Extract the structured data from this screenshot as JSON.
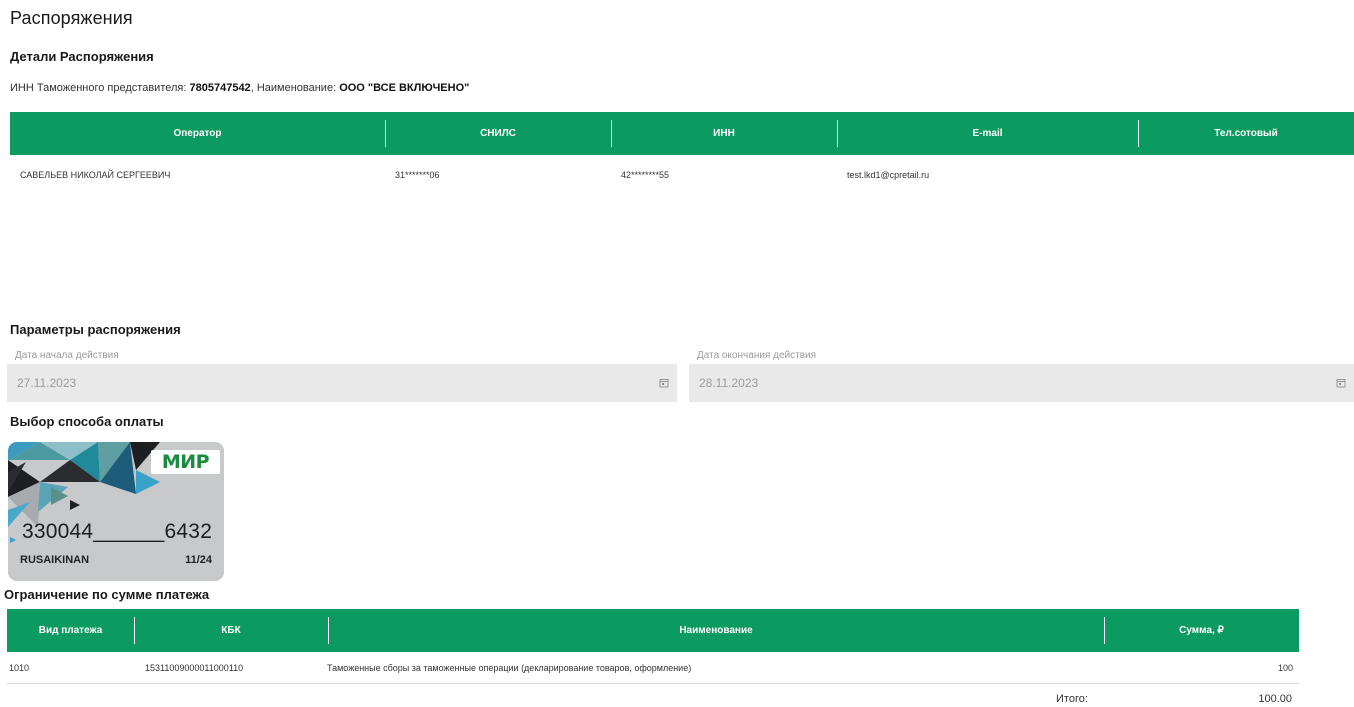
{
  "page": {
    "title": "Распоряжения"
  },
  "details": {
    "title": "Детали Распоряжения",
    "inn_label": "ИНН Таможенного представителя:",
    "inn_value": "7805747542",
    "name_label": "Наименование:",
    "name_value": "ООО \"ВСЕ ВКЛЮЧЕНО\""
  },
  "operators_table": {
    "headers": [
      "Оператор",
      "СНИЛС",
      "ИНН",
      "E-mail",
      "Тел.сотовый"
    ],
    "rows": [
      {
        "operator": "САВЕЛЬЕВ НИКОЛАЙ СЕРГЕЕВИЧ",
        "snils": "31*******06",
        "inn": "42********55",
        "email": "test.lkd1@cpretail.ru",
        "phone": ""
      }
    ]
  },
  "params": {
    "title": "Параметры распоряжения",
    "start": {
      "label": "Дата начала действия",
      "value": "27.11.2023",
      "icon": "calendar-icon"
    },
    "end": {
      "label": "Дата окончания действия",
      "value": "28.11.2023",
      "icon": "calendar-icon"
    }
  },
  "payment": {
    "title": "Выбор способа оплаты",
    "card": {
      "brand": "МИР",
      "number": "330044______6432",
      "holder": "RUSAIKINAN",
      "expiry": "11/24"
    }
  },
  "limits": {
    "title": "Ограничение по сумме платежа",
    "headers": [
      "Вид платежа",
      "КБК",
      "Наименование",
      "Сумма, ₽"
    ],
    "rows": [
      {
        "type": "1010",
        "kbk": "15311009000011000110",
        "name": "Таможенные сборы за таможенные операции (декларирование товаров, оформление)",
        "amount": "100"
      }
    ],
    "total_label": "Итого:",
    "total_value": "100.00"
  },
  "colors": {
    "accent": "#0b9a5f",
    "field_bg": "#e9e9e9",
    "mir_green": "#1b8c3f"
  }
}
